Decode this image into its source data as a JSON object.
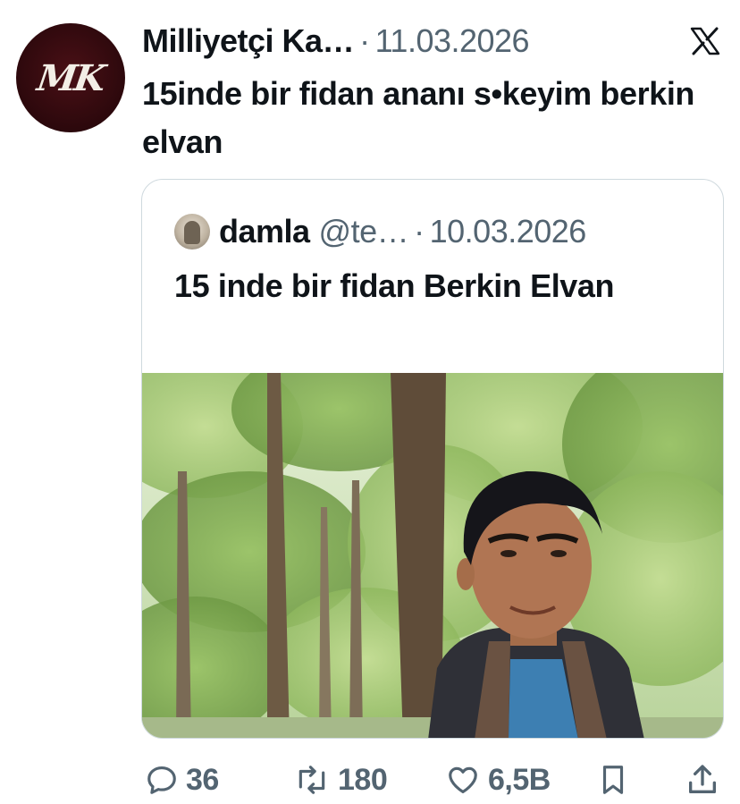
{
  "tweet": {
    "author": {
      "name": "Milliyetçi Ka…",
      "avatar_logo": "MK"
    },
    "separator": "·",
    "date": "11.03.2026",
    "text": "15inde bir fidan ananı s•keyim berkin elvan",
    "platform_icon": "x-logo-icon"
  },
  "quoted": {
    "author": {
      "name": "damla",
      "handle": "@te…"
    },
    "separator": "·",
    "date": "10.03.2026",
    "text": "15 inde bir fidan Berkin Elvan",
    "media": "photo-boy-in-forest"
  },
  "actions": {
    "replies": "36",
    "reposts": "180",
    "likes": "6,5B"
  },
  "colors": {
    "text": "#0f1419",
    "secondary": "#536471",
    "border": "#cfd9de",
    "avatar_bg": "#2c080c"
  }
}
